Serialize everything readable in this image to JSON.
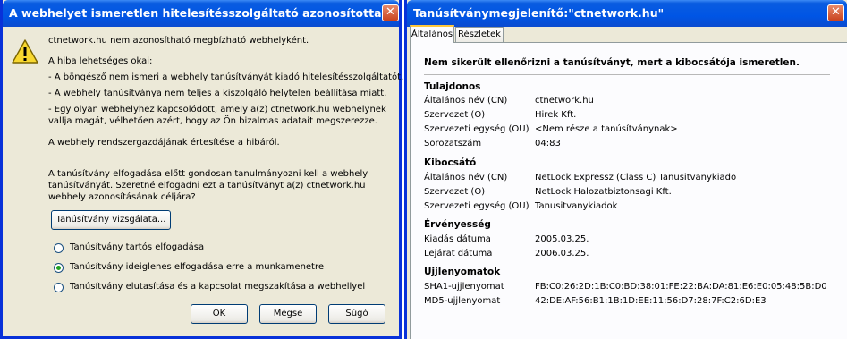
{
  "left_dialog": {
    "title": "A webhelyet ismeretlen hitelesítésszolgáltató azonosította",
    "close_glyph": "✕",
    "intro": "ctnetwork.hu nem azonosítható megbízható webhelyként.",
    "reasons_heading": "A hiba lehetséges okai:",
    "reason1": "- A böngésző nem ismeri a webhely tanúsítványát kiadó hitelesítésszolgáltatót.",
    "reason2": "- A webhely tanúsítványa nem teljes a kiszolgáló helytelen beállítása miatt.",
    "reason3_line1": "- Egy olyan webhelyhez kapcsolódott, amely a(z) ctnetwork.hu webhelynek",
    "reason3_line2": "vallja magát, vélhetően azért, hogy az Ön bizalmas adatait megszerezze.",
    "notify": "A webhely rendszergazdájának értesítése a hibáról.",
    "advice_line1": "A tanúsítvány elfogadása előtt gondosan tanulmányozni kell a webhely",
    "advice_line2": "tanúsítványát. Szeretné elfogadni ezt a tanúsítványt a(z) ctnetwork.hu",
    "advice_line3": "webhely azonosításának céljára?",
    "examine_button": "Tanúsítvány vizsgálata...",
    "options": [
      "Tanúsítvány tartós elfogadása",
      "Tanúsítvány ideiglenes elfogadása erre a munkamenetre",
      "Tanúsítvány elutasítása és a kapcsolat megszakítása a webhellyel"
    ],
    "ok_button": "OK",
    "cancel_button": "Mégse",
    "help_button": "Súgó",
    "warning_icon": "warning-icon"
  },
  "right_dialog": {
    "title": "Tanúsítványmegjelenítő:\"ctnetwork.hu\"",
    "close_glyph": "✕",
    "tabs": [
      "Általános",
      "Részletek"
    ],
    "status": "Nem sikerült ellenőrizni a tanúsítványt, mert a kibocsátója ismeretlen.",
    "sections": {
      "owner": {
        "heading": "Tulajdonos",
        "rows": [
          {
            "label": "Általános név (CN)",
            "value": "ctnetwork.hu"
          },
          {
            "label": "Szervezet (O)",
            "value": "Hirek Kft."
          },
          {
            "label": "Szervezeti egység (OU)",
            "value": "<Nem része a tanúsítványnak>"
          },
          {
            "label": "Sorozatszám",
            "value": "04:83"
          }
        ]
      },
      "issuer": {
        "heading": "Kibocsátó",
        "rows": [
          {
            "label": "Általános név (CN)",
            "value": "NetLock Expressz (Class C) Tanusitvanykiado"
          },
          {
            "label": "Szervezet (O)",
            "value": "NetLock Halozatbiztonsagi Kft."
          },
          {
            "label": "Szervezeti egység (OU)",
            "value": "Tanusitvanykiadok"
          }
        ]
      },
      "validity": {
        "heading": "Érvényesség",
        "rows": [
          {
            "label": "Kiadás dátuma",
            "value": "2005.03.25."
          },
          {
            "label": "Lejárat dátuma",
            "value": "2006.03.25."
          }
        ]
      },
      "fingerprints": {
        "heading": "Ujjlenyomatok",
        "rows": [
          {
            "label": "SHA1-ujjlenyomat",
            "value": "FB:C0:26:2D:1B:C0:BD:38:01:FE:22:BA:DA:81:E6:E0:05:48:5B:D0"
          },
          {
            "label": "MD5-ujjlenyomat",
            "value": "42:DE:AF:56:B1:1B:1D:EE:11:56:D7:28:7F:C2:6D:E3"
          }
        ]
      }
    }
  }
}
